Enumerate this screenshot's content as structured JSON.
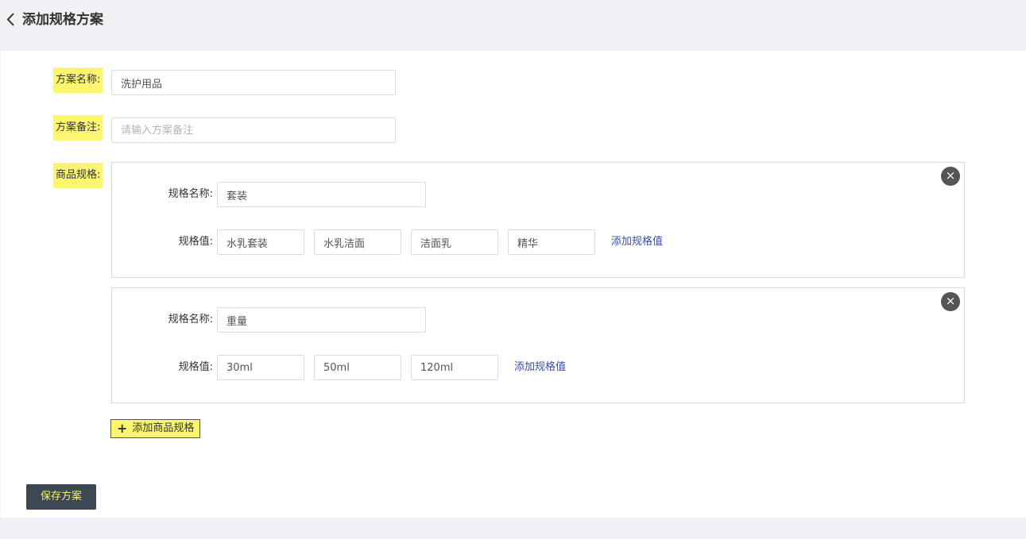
{
  "header": {
    "title": "添加规格方案",
    "back_icon": "chevron-left-icon"
  },
  "form": {
    "plan_name": {
      "label": "方案名称:",
      "value": "洗护用品",
      "placeholder": ""
    },
    "plan_remark": {
      "label": "方案备注:",
      "value": "",
      "placeholder": "请输入方案备注"
    },
    "specs_label": "商品规格:"
  },
  "specs": [
    {
      "name_label": "规格名称:",
      "name_value": "套装",
      "values_label": "规格值:",
      "values": [
        "水乳套装",
        "水乳洁面",
        "洁面乳",
        "精华"
      ],
      "add_value_label": "添加规格值",
      "close_label": "×"
    },
    {
      "name_label": "规格名称:",
      "name_value": "重量",
      "values_label": "规格值:",
      "values": [
        "30ml",
        "50ml",
        "120ml"
      ],
      "add_value_label": "添加规格值",
      "close_label": "×"
    }
  ],
  "add_spec_button": {
    "icon": "+",
    "label": "添加商品规格"
  },
  "save_button": {
    "label": "保存方案"
  },
  "colors": {
    "highlight": "#fbf56f",
    "link": "#3c4c9e",
    "dark_button": "#3d4751",
    "page_bg": "#f0f1f5"
  }
}
